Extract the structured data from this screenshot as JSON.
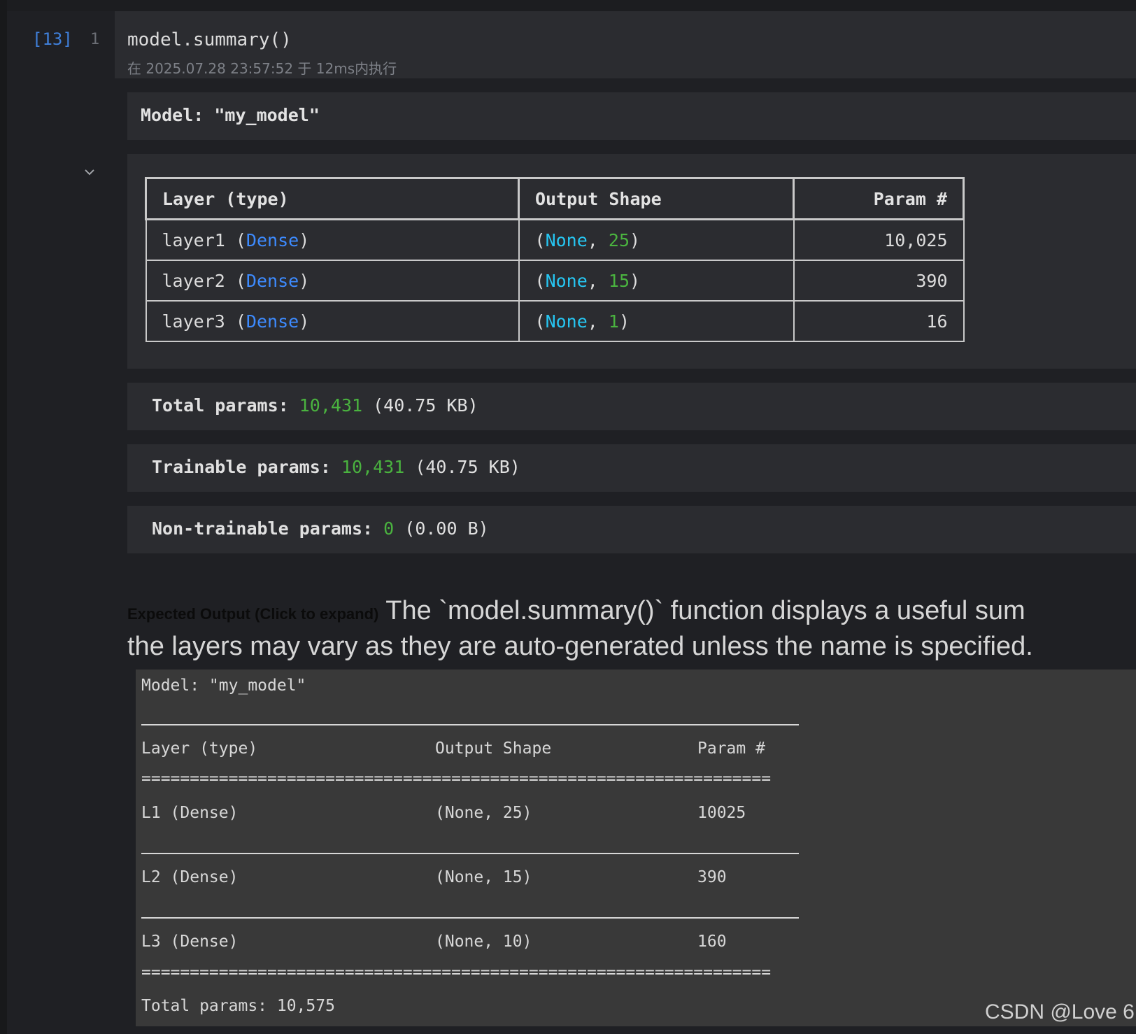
{
  "cell": {
    "exec_count": "[13]",
    "line_number": "1",
    "code": "model.summary()",
    "exec_meta": "在 2025.07.28 23:57:52 于 12ms内执行"
  },
  "output": {
    "model_title": "Model: \"my_model\"",
    "headers": [
      "Layer (type)",
      "Output Shape",
      "Param #"
    ],
    "rows": [
      {
        "name": "layer1",
        "type": "Dense",
        "none": "None",
        "dim": "25",
        "params": "10,025"
      },
      {
        "name": "layer2",
        "type": "Dense",
        "none": "None",
        "dim": "15",
        "params": "390"
      },
      {
        "name": "layer3",
        "type": "Dense",
        "none": "None",
        "dim": "1",
        "params": "16"
      }
    ],
    "total": {
      "label": "Total params:",
      "value": "10,431",
      "size": "(40.75 KB)"
    },
    "trainable": {
      "label": "Trainable params:",
      "value": "10,431",
      "size": "(40.75 KB)"
    },
    "non_trainable": {
      "label": "Non-trainable params:",
      "value": "0",
      "size": "(0.00 B)"
    }
  },
  "markdown": {
    "expand_label": "Expected Output (Click to expand)",
    "line1": "The `model.summary()` function displays a useful sum",
    "line2": "the layers may vary as they are auto-generated unless the name is specified."
  },
  "expected": {
    "model_line": "Model: \"my_model\"",
    "header": {
      "layer": "Layer (type)",
      "shape": "Output Shape",
      "param": "Param #"
    },
    "double_rule": "=================================================================",
    "rows": [
      {
        "layer": "L1 (Dense)",
        "shape": "(None, 25)",
        "param": "10025"
      },
      {
        "layer": "L2 (Dense)",
        "shape": "(None, 15)",
        "param": "390"
      },
      {
        "layer": "L3 (Dense)",
        "shape": "(None, 10)",
        "param": "160"
      }
    ],
    "total": "Total params: 10,575"
  },
  "watermark": "CSDN @Love 6",
  "colors": {
    "keyword": "#3d8bff",
    "none": "#26c6f2",
    "number": "#4ab33f",
    "exec_count": "#3f7fd9"
  }
}
